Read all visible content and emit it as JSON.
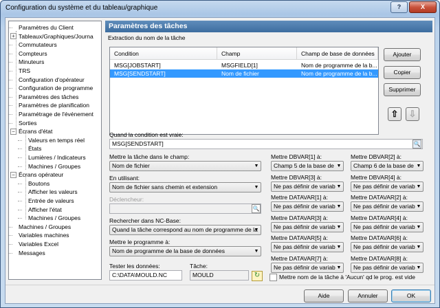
{
  "window": {
    "title": "Configuration du système et du tableau/graphique",
    "help_glyph": "?",
    "close_glyph": "X"
  },
  "tree": {
    "items": [
      {
        "label": "Paramètres du Client"
      },
      {
        "label": "Tableaux/Graphiques/Journa",
        "expander": "+"
      },
      {
        "label": "Commutateurs"
      },
      {
        "label": "Compteurs"
      },
      {
        "label": "Minuteurs"
      },
      {
        "label": "TRS"
      },
      {
        "label": "Configuration d'opérateur"
      },
      {
        "label": "Configuration de programme"
      },
      {
        "label": "Paramètres des tâches"
      },
      {
        "label": "Paramètres de planification"
      },
      {
        "label": "Paramétrage de l'événement"
      },
      {
        "label": "Sorties"
      },
      {
        "label": "Écrans d'état",
        "expander": "−"
      },
      {
        "label": "Valeurs en temps réel"
      },
      {
        "label": "États"
      },
      {
        "label": "Lumières / Indicateurs"
      },
      {
        "label": "Machines / Groupes"
      },
      {
        "label": "Écrans opérateur",
        "expander": "−"
      },
      {
        "label": "Boutons"
      },
      {
        "label": "Afficher les valeurs"
      },
      {
        "label": "Entrée de valeurs"
      },
      {
        "label": "Afficher l'état"
      },
      {
        "label": "Machines / Groupes"
      },
      {
        "label": "Machines / Groupes"
      },
      {
        "label": "Variables machines"
      },
      {
        "label": "Variables Excel"
      },
      {
        "label": "Messages"
      }
    ]
  },
  "panel": {
    "title": "Paramètres des tâches",
    "section_label": "Extraction du nom de la tâche",
    "table": {
      "columns": [
        "Condition",
        "Champ",
        "Champ de base de données"
      ],
      "rows": [
        [
          "MSG[JOBSTART]",
          "MSGFIELD[1]",
          "Nom de programme de la b..."
        ],
        [
          "MSG[SENDSTART]",
          "Nom de fichier",
          "Nom de programme de la b..."
        ]
      ],
      "selected_row": 1
    },
    "buttons": {
      "add": "Ajouter",
      "copy": "Copier",
      "delete": "Supprimer",
      "up_glyph": "⇧",
      "down_glyph": "⇩"
    },
    "condition_label": "Quand la condition est vraie:",
    "condition_value": "MSG[SENDSTART]",
    "field_label": "Mettre la tâche dans le champ:",
    "field_value": "Nom de fichier",
    "using_label": "En utilisant:",
    "using_value": "Nom de fichier sans chemin et extension",
    "trigger_label": "Déclencheur:",
    "trigger_value": "",
    "ncbase_label": "Rechercher dans NC-Base:",
    "ncbase_value": "Quand la tâche correspond au nom de programme de la",
    "program_label": "Mettre le programme à:",
    "program_value": "Nom de programme de la base de données",
    "test_label": "Tester les données:",
    "test_value": "C:\\DATA\\MOULD.NC",
    "task_label": "Tâche:",
    "task_value": "MOULD",
    "vars": [
      {
        "label": "Mettre DBVAR[1] à:",
        "value": "Champ 5 de la base de"
      },
      {
        "label": "Mettre DBVAR[2] à:",
        "value": "Champ 6 de la base de"
      },
      {
        "label": "Mettre DBVAR[3] à:",
        "value": "Ne pas définir de variab"
      },
      {
        "label": "Mettre DBVAR[4] à:",
        "value": "Ne pas définir de variab"
      },
      {
        "label": "Mettre DATAVAR[1] à:",
        "value": "Ne pas définir de variab"
      },
      {
        "label": "Mettre DATAVAR[2] à:",
        "value": "Ne pas définir de variab"
      },
      {
        "label": "Mettre DATAVAR[3] à:",
        "value": "Ne pas définir de variab"
      },
      {
        "label": "Mettre DATAVAR[4] à:",
        "value": "Ne pas définir de variab"
      },
      {
        "label": "Mettre DATAVAR[5] à:",
        "value": "Ne pas définir de variab"
      },
      {
        "label": "Mettre DATAVAR[6] à:",
        "value": "Ne pas définir de variab"
      },
      {
        "label": "Mettre DATAVAR[7] à:",
        "value": "Ne pas définir de variab"
      },
      {
        "label": "Mettre DATAVAR[8] à:",
        "value": "Ne pas définir de variab"
      }
    ],
    "checkbox_label": "Mettre nom de la tâche à 'Aucun' qd le prog. est vide",
    "checkbox_checked": false
  },
  "footer": {
    "help": "Aide",
    "cancel": "Annuler",
    "ok": "OK"
  }
}
